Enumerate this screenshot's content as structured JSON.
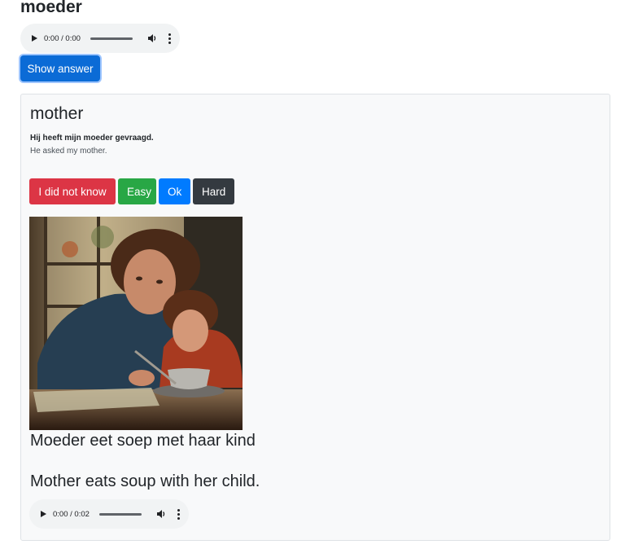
{
  "prompt": {
    "word": "moeder",
    "audio": {
      "time": "0:00 / 0:00"
    }
  },
  "show_answer_label": "Show answer",
  "card": {
    "answer": "mother",
    "example_nl": "Hij heeft mijn moeder gevraagd.",
    "example_en": "He asked my mother.",
    "buttons": {
      "dont_know": "I did not know",
      "easy": "Easy",
      "ok": "Ok",
      "hard": "Hard"
    },
    "colors": {
      "dont_know": "#dc3545",
      "easy": "#28a745",
      "ok": "#007bff",
      "hard": "#343a40",
      "show_answer": "#0b6bd6"
    },
    "image_alt": "Painting of a mother and child eating soup at a wooden table by a window",
    "caption_nl": "Moeder eet soep met haar kind",
    "caption_en": "Mother eats soup with her child.",
    "audio": {
      "time": "0:00 / 0:02"
    }
  }
}
